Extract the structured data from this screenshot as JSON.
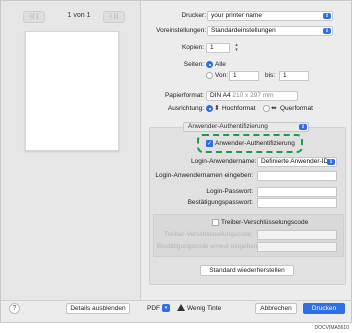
{
  "preview": {
    "page_count": "1 von 1",
    "nav_first": "⟨⟨  ⟨",
    "nav_last": "⟩  ⟩⟩"
  },
  "printer": {
    "label": "Drucker:",
    "value": "your printer name"
  },
  "presets": {
    "label": "Voreinstellungen:",
    "value": "Standardeinstellungen"
  },
  "copies": {
    "label": "Kopien:",
    "value": "1"
  },
  "pages": {
    "label": "Seiten:",
    "all": "Alle",
    "from_label": "Von:",
    "from_value": "1",
    "to_label": "bis:",
    "to_value": "1"
  },
  "paper": {
    "label": "Papierformat:",
    "value": "DIN A4",
    "dims": "210 x 297 mm"
  },
  "orientation": {
    "label": "Ausrichtung:",
    "portrait": "Hochformat",
    "landscape": "Querformat"
  },
  "section_select": {
    "value": "Anwender-Authentifizierung"
  },
  "auth": {
    "checkbox_label": "Anwender-Authentifizierung",
    "login_name_label": "Login-Anwendername:",
    "login_name_value": "Definierte Anwender-ID",
    "login_name_input_label": "Login-Anwendernamen eingeben:",
    "password_label": "Login-Passwort:",
    "password_confirm_label": "Bestätigungspasswort:",
    "encryption_label": "Treiber-Verschlüsselungscode",
    "encryption_code_label": "Treiber-Verschlüsselungscode:",
    "encryption_confirm_label": "Bestätigungscode erneut eingeben:",
    "restore_button": "Standard wiederherstellen"
  },
  "footer": {
    "help": "?",
    "details_button": "Details ausblenden",
    "pdf": "PDF",
    "warning": "Wenig Tinte",
    "cancel_button": "Abbrechen",
    "print_button": "Drucken"
  },
  "figure_code": "DOCVIMA5610",
  "colors": {
    "accent": "#2c6fe6",
    "highlight": "#1e9a4a"
  }
}
